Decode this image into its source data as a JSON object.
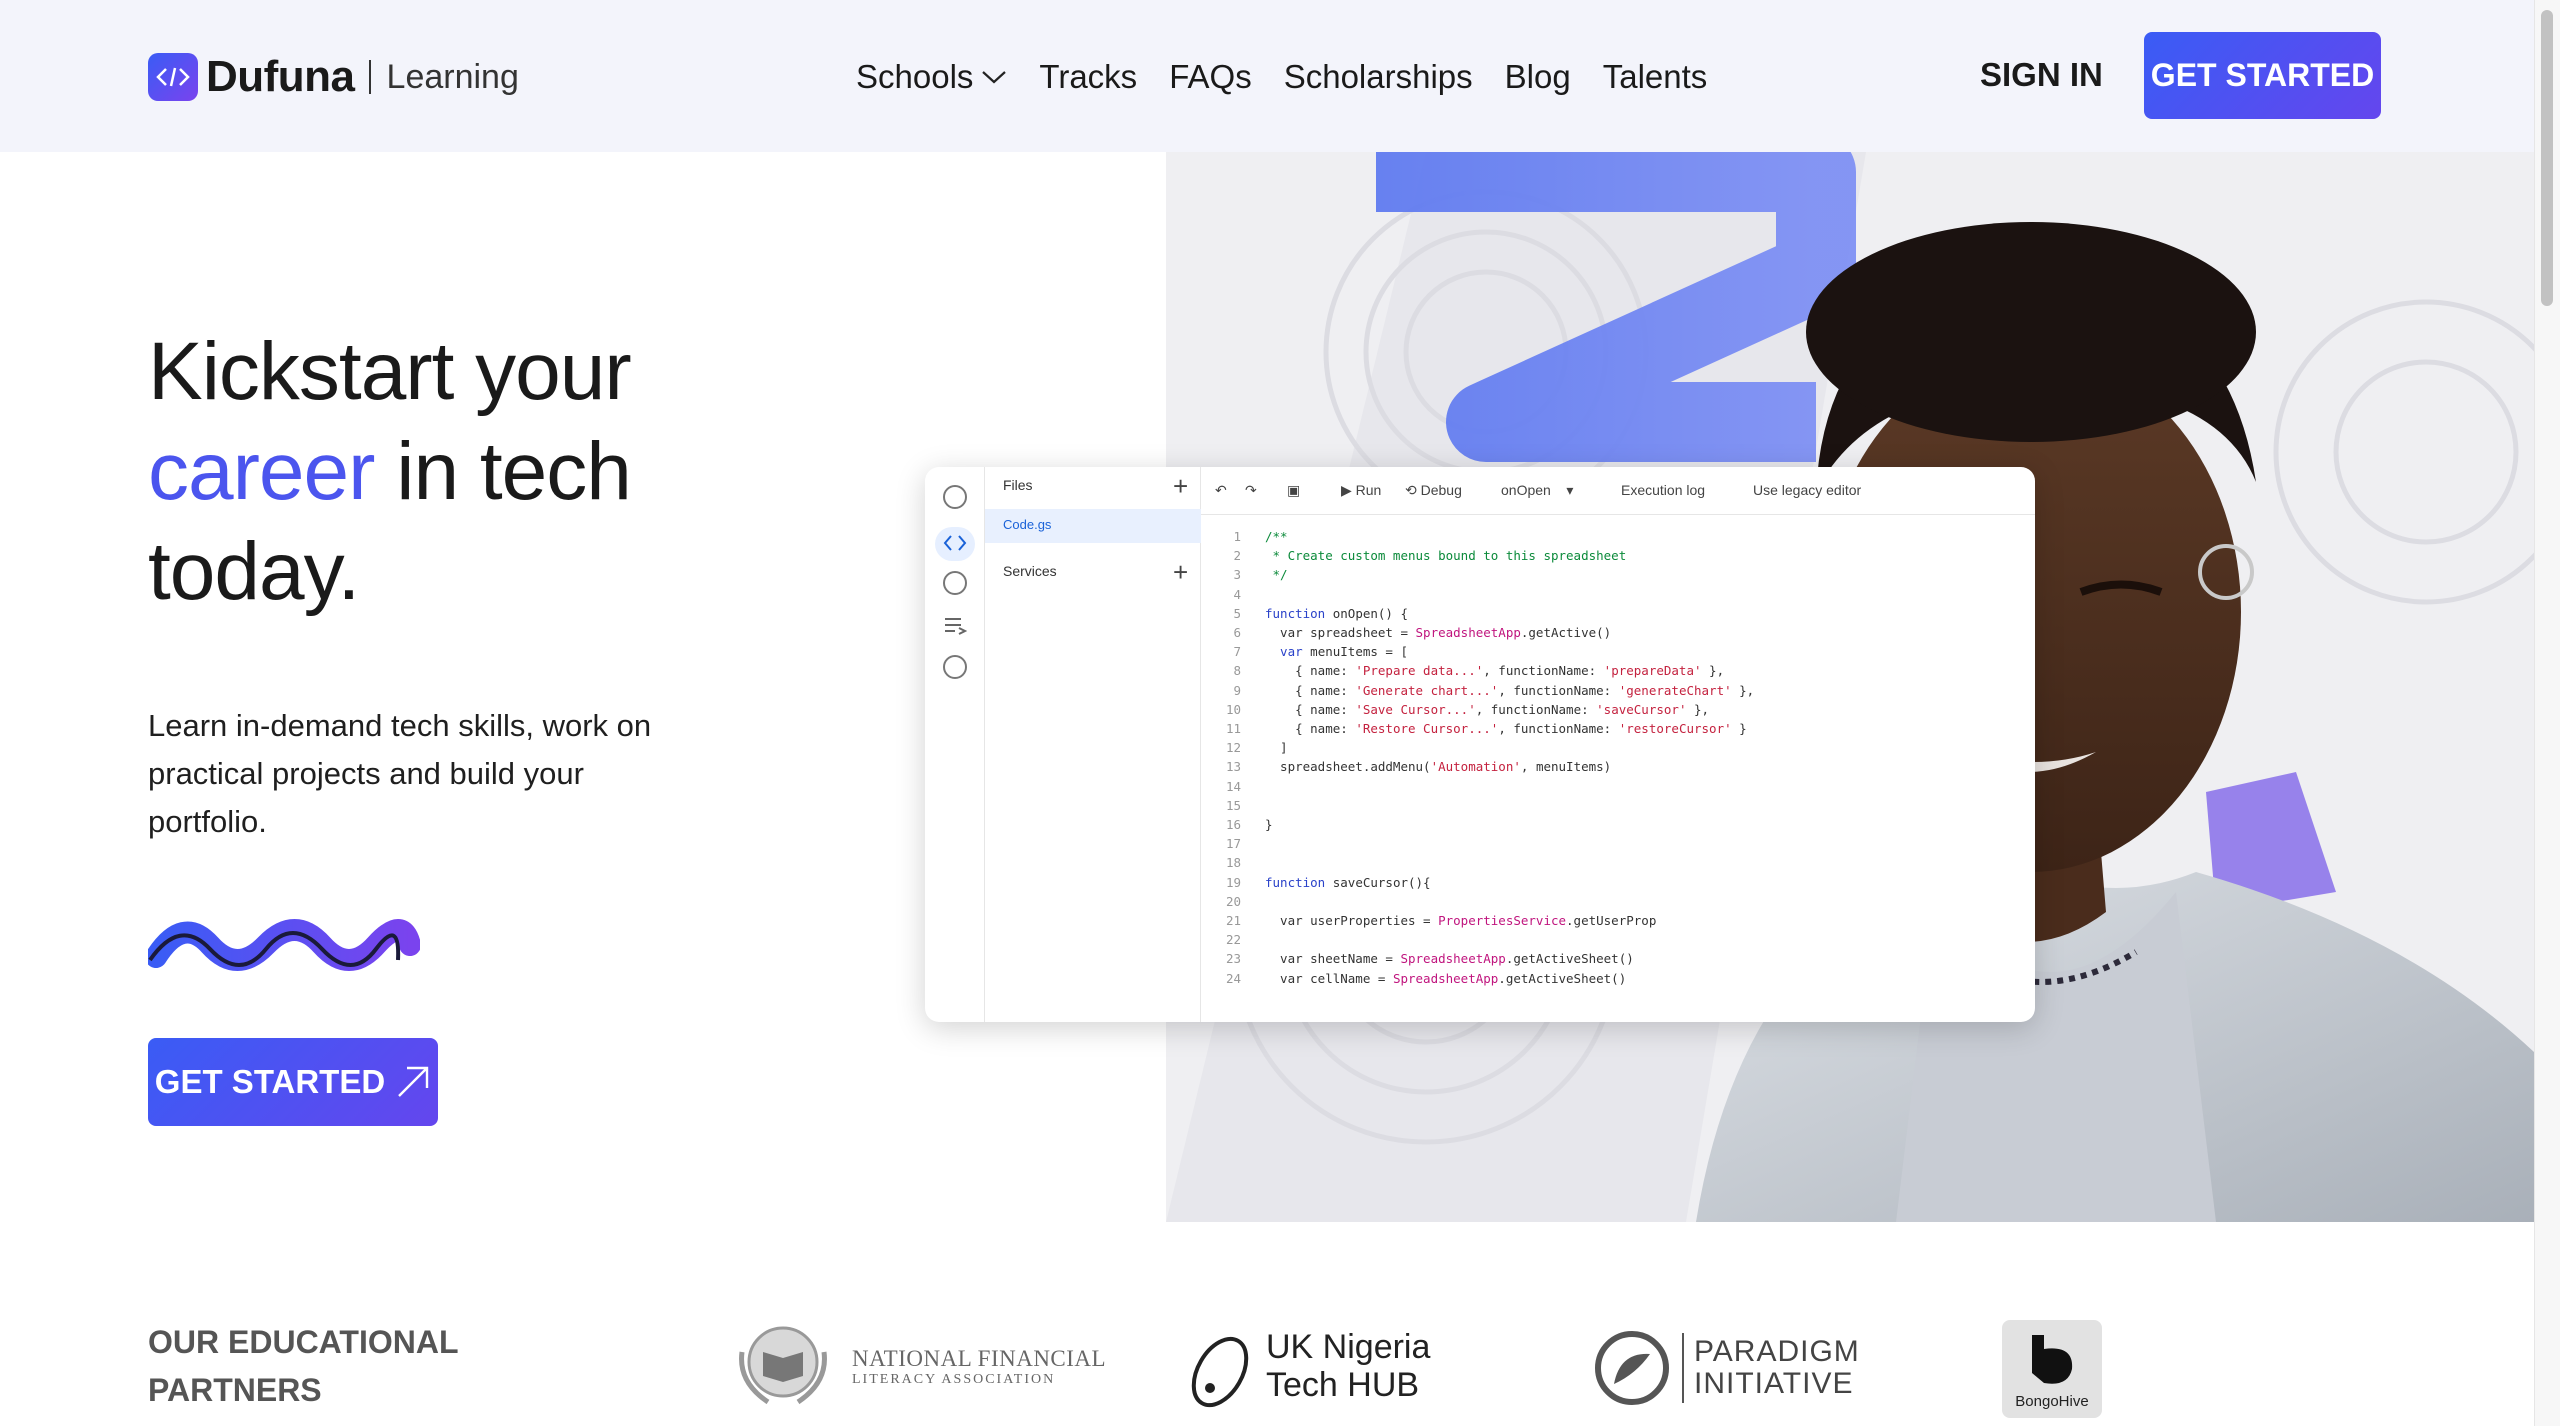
{
  "brand": {
    "name": "Dufuna",
    "sub": "Learning"
  },
  "nav": {
    "items": [
      "Schools",
      "Tracks",
      "FAQs",
      "Scholarships",
      "Blog",
      "Talents"
    ],
    "signin": "SIGN IN",
    "cta": "GET STARTED"
  },
  "hero": {
    "title_1": "Kickstart your",
    "title_accent": "career",
    "title_2": " in tech",
    "title_3": "today.",
    "subtitle": "Learn in-demand tech skills, work on practical projects and build your portfolio.",
    "cta": "GET STARTED"
  },
  "editor": {
    "files_label": "Files",
    "file_name": "Code.gs",
    "services_label": "Services",
    "toolbar": {
      "run": "Run",
      "debug": "Debug",
      "function": "onOpen",
      "exec_log": "Execution log",
      "legacy": "Use legacy editor"
    },
    "line_numbers": [
      "1",
      "2",
      "3",
      "4",
      "5",
      "6",
      "7",
      "8",
      "9",
      "10",
      "11",
      "12",
      "13",
      "14",
      "15",
      "16",
      "17",
      "18",
      "19",
      "20",
      "21",
      "22",
      "23",
      "24"
    ],
    "code": {
      "l1": "/**",
      "l2": " * Create custom menus bound to this spreadsheet",
      "l3": " */",
      "l5a": "function",
      "l5b": " onOpen() {",
      "l6a": "  var spreadsheet = ",
      "l6b": "SpreadsheetApp",
      "l6c": ".getActive()",
      "l7a": "  var",
      "l7b": " menuItems = [",
      "l8a": "    { name: ",
      "l8b": "'Prepare data...'",
      "l8c": ", functionName: ",
      "l8d": "'prepareData'",
      "l8e": " },",
      "l9a": "    { name: ",
      "l9b": "'Generate chart...'",
      "l9c": ", functionName: ",
      "l9d": "'generateChart'",
      "l9e": " },",
      "l10a": "    { name: ",
      "l10b": "'Save Cursor...'",
      "l10c": ", functionName: ",
      "l10d": "'saveCursor'",
      "l10e": " },",
      "l11a": "    { name: ",
      "l11b": "'Restore Cursor...'",
      "l11c": ", functionName: ",
      "l11d": "'restoreCursor'",
      "l11e": " }",
      "l12": "  ]",
      "l13a": "  spreadsheet.addMenu(",
      "l13b": "'Automation'",
      "l13c": ", menuItems)",
      "l16": "}",
      "l19a": "function",
      "l19b": " saveCursor(){",
      "l21a": "  var userProperties = ",
      "l21b": "PropertiesService",
      "l21c": ".getUserProp",
      "l23a": "  var sheetName = ",
      "l23b": "SpreadsheetApp",
      "l23c": ".getActiveSheet()",
      "l24a": "  var cellName = ",
      "l24b": "SpreadsheetApp",
      "l24c": ".getActiveSheet()"
    }
  },
  "partners": {
    "heading": "OUR EDUCATIONAL PARTNERS",
    "nfla_a": "NATIONAL FINANCIAL",
    "nfla_b": "LITERACY ASSOCIATION",
    "uk_a": "UK Nigeria",
    "uk_b": "Tech HUB",
    "paradigm_a": "PARADIGM",
    "paradigm_b": "INITIATIVE",
    "bongo": "BongoHive"
  },
  "colors": {
    "accent": "#4b55ee",
    "brand_gradient_start": "#3a5cf5",
    "brand_gradient_end": "#6446ee",
    "nav_bg": "#f3f4fb"
  }
}
